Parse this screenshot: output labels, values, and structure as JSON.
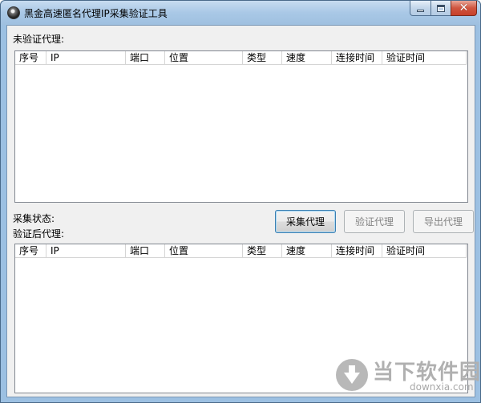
{
  "window": {
    "title": "黑金高速匿名代理IP采集验证工具",
    "close_glyph": "✕"
  },
  "unverified": {
    "label": "未验证代理:",
    "columns": [
      "序号",
      "IP",
      "端口",
      "位置",
      "类型",
      "速度",
      "连接时间",
      "验证时间"
    ]
  },
  "status": {
    "label": "采集状态:"
  },
  "verified": {
    "label": "验证后代理:",
    "columns": [
      "序号",
      "IP",
      "端口",
      "位置",
      "类型",
      "速度",
      "连接时间",
      "验证时间"
    ]
  },
  "buttons": {
    "collect": "采集代理",
    "verify": "验证代理",
    "export": "导出代理"
  },
  "watermark": {
    "text": "当下软件园",
    "sub": "downxia.com"
  }
}
